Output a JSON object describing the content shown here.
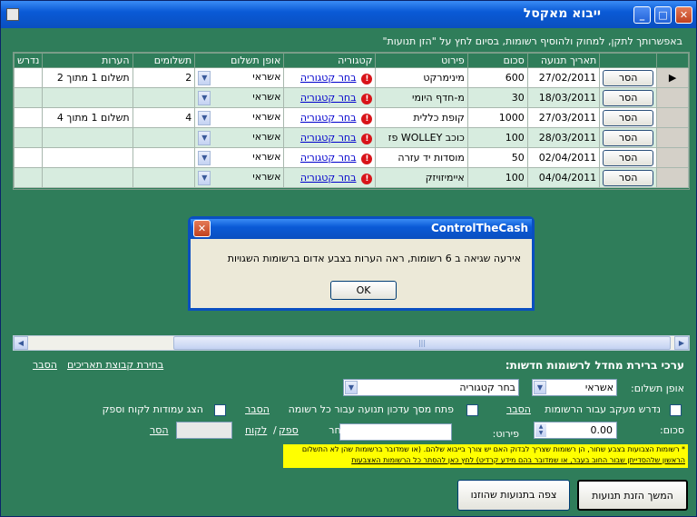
{
  "window": {
    "title": "ייבוא מאקסל"
  },
  "hint": "באפשרותך לתקן, למחוק ולהוסיף רשומות, בסיום לחץ על \"הזן תנועות\"",
  "grid": {
    "columns": {
      "date": "תאריך תנועה",
      "amount": "סכום",
      "details": "פירוט",
      "category": "קטגוריה",
      "payment": "אופן תשלום",
      "installments": "תשלומים",
      "notes": "הערות",
      "extra": "נדרש"
    },
    "delete_label": "הסר",
    "rows": [
      {
        "date": "27/02/2011",
        "amount": "600",
        "details": "מינימרקט",
        "category": "בחר קטגוריה",
        "payment": "אשראי",
        "installments": "2",
        "notes": "2 תשלום 1 מתוך"
      },
      {
        "date": "18/03/2011",
        "amount": "30",
        "details": "מ-חדף היומי",
        "category": "בחר קטגוריה",
        "payment": "אשראי",
        "installments": "",
        "notes": ""
      },
      {
        "date": "27/03/2011",
        "amount": "1000",
        "details": "קופת כללית",
        "category": "בחר קטגוריה",
        "payment": "אשראי",
        "installments": "4",
        "notes": "4 תשלום 1 מתוך"
      },
      {
        "date": "28/03/2011",
        "amount": "100",
        "details": "פז WOLLEY כוכב",
        "category": "בחר קטגוריה",
        "payment": "אשראי",
        "installments": "",
        "notes": ""
      },
      {
        "date": "02/04/2011",
        "amount": "50",
        "details": "מוסדות יד עזרה",
        "category": "בחר קטגוריה",
        "payment": "אשראי",
        "installments": "",
        "notes": ""
      },
      {
        "date": "04/04/2011",
        "amount": "100",
        "details": "איימיזויזק",
        "category": "בחר קטגוריה",
        "payment": "אשראי",
        "installments": "",
        "notes": ""
      }
    ]
  },
  "dialog": {
    "title": "ControlTheCash",
    "message": "אירעה שגיאה ב 6 רשומות, ראה הערות בצבע אדום ברשומות השגויות",
    "ok_label": "OK"
  },
  "defaults": {
    "section_title": "ערכי ברירת מחדל לרשומות חדשות:",
    "explain_link": "הסבר",
    "date_group_link": "בחירת קבוצת תאריכים",
    "payment_label": "אופן תשלום:",
    "payment_value": "אשראי",
    "category_value": "בחר קטגוריה",
    "track_label": "נדרש מעקב עבור הרשומות",
    "track_explain": "הסבר",
    "open_screen_label": "פתח מסך עדכון תנועה עבור כל רשומה",
    "open_screen_explain": "הסבר",
    "show_columns_label": "הצג עמודות לקוח וספק",
    "amount_label": "סכום:",
    "amount_value": "0.00",
    "details_label": "פירוט:",
    "choose_label": "בחר",
    "supplier_link": "ספק",
    "slash": "/",
    "customer_link": "לקוח",
    "remove_link": "הסר"
  },
  "warning": {
    "line1": "* רשומות הצבועות בצבע שחור, הן רשומות שצריך לבדוק האם יש צורך בייבוא שלהם. (או שמדובר ברשומות שהן לא התשלום",
    "line2": "הראשון שלהסדייתן שבור החוב בעבר, או שמדובר בהם מידע קרדיט) לחץ כאן להסתר כל הרשומות האצבעות"
  },
  "buttons": {
    "continue": "המשך הזנת תנועות",
    "view_imported": "צפה בתנועות שהוזנו"
  }
}
